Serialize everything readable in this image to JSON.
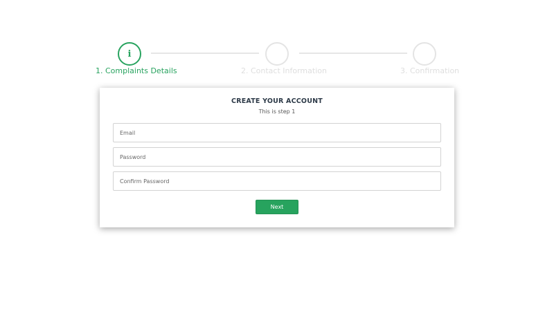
{
  "colors": {
    "accent": "#28a35f",
    "inactive": "#dedede",
    "title": "#2d3a48"
  },
  "stepper": {
    "steps": [
      {
        "label": "1. Complaints Details",
        "icon": "info-icon",
        "icon_glyph": "i",
        "active": true
      },
      {
        "label": "2. Contact Information",
        "active": false
      },
      {
        "label": "3. Confirmation",
        "active": false
      }
    ]
  },
  "form": {
    "title": "CREATE YOUR ACCOUNT",
    "subtitle": "This is step 1",
    "email": {
      "placeholder": "Email",
      "value": ""
    },
    "password": {
      "placeholder": "Password",
      "value": ""
    },
    "confirm_password": {
      "placeholder": "Confirm Password",
      "value": ""
    },
    "next_label": "Next"
  }
}
